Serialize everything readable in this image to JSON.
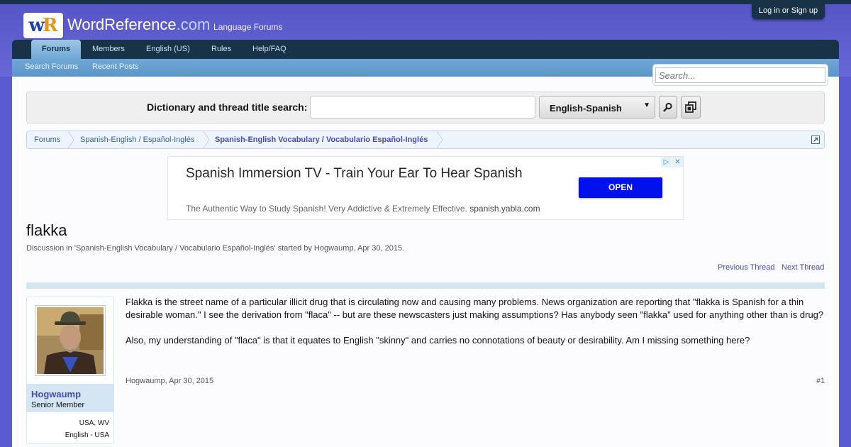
{
  "header": {
    "brand_name": "WordReference",
    "brand_tld": ".com",
    "brand_sub": "Language Forums",
    "login": "Log in or Sign up",
    "colors": {
      "header": "#5b5bd1",
      "navbar": "#183247",
      "accent": "#4a4ab8"
    }
  },
  "nav": {
    "tabs": [
      {
        "label": "Forums",
        "active": true
      },
      {
        "label": "Members"
      },
      {
        "label": "English (US)"
      },
      {
        "label": "Rules"
      },
      {
        "label": "Help/FAQ"
      }
    ],
    "subtabs": [
      {
        "label": "Search Forums"
      },
      {
        "label": "Recent Posts"
      }
    ]
  },
  "search": {
    "placeholder": "Search..."
  },
  "dictionary": {
    "label": "Dictionary and thread title search:",
    "value": "",
    "selected_language": "English-Spanish"
  },
  "breadcrumb": [
    {
      "label": "Forums"
    },
    {
      "label": "Spanish-English / Español-Inglés"
    },
    {
      "label": "Spanish-English Vocabulary / Vocabulario Español-Inglés",
      "current": true
    }
  ],
  "ad": {
    "title": "Spanish Immersion TV - Train Your Ear To Hear Spanish",
    "description": "The Authentic Way to Study Spanish! Very Addictive & Extremely Effective.",
    "domain": "spanish.yabla.com",
    "cta": "OPEN"
  },
  "thread": {
    "title": "flakka",
    "meta": "Discussion in 'Spanish-English Vocabulary / Vocabulario Español-Inglés' started by Hogwaump, Apr 30, 2015.",
    "prev": "Previous Thread",
    "next": "Next Thread"
  },
  "post": {
    "user": {
      "name": "Hogwaump",
      "title": "Senior Member",
      "location": "USA, WV",
      "language": "English - USA"
    },
    "paragraphs": [
      "Flakka is the street name of a particular illicit drug that is circulating now and causing many problems. News organization are reporting that \"flakka is Spanish for a thin desirable woman.\" I see the derivation from \"flaca\" -- but are these newscasters just making assumptions? Has anybody seen \"flakka\" used for anything other than is drug?",
      "Also, my understanding of \"flaca\" is that it equates to English \"skinny\" and carries no connotations of beauty or desirability. Am I missing something here?"
    ],
    "author": "Hogwaump",
    "date": "Apr 30, 2015",
    "number": "#1"
  }
}
